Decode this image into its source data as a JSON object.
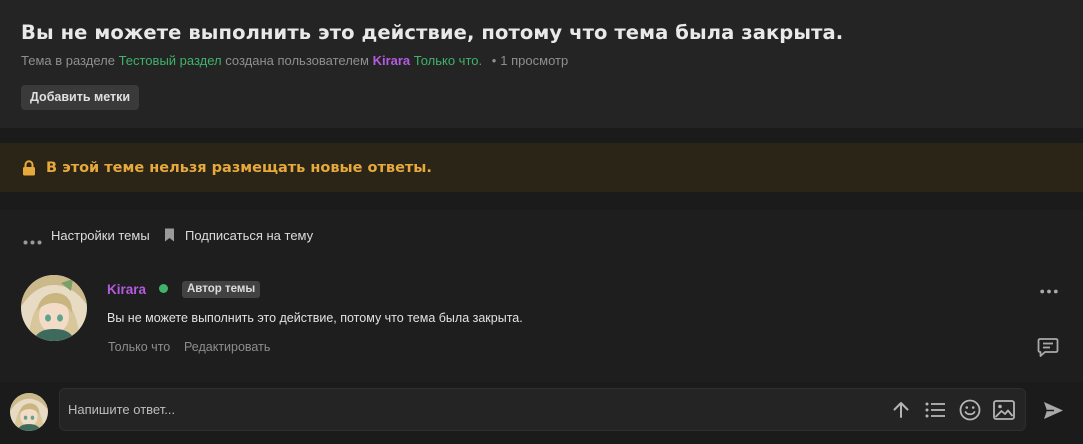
{
  "thread": {
    "title": "Вы не можете выполнить это действие, потому что тема была закрыта.",
    "meta": {
      "prefix": "Тема в разделе",
      "section": "Тестовый раздел",
      "middle": "создана пользователем",
      "author": "Kirara",
      "time": "Только что.",
      "separator": "•",
      "views": "1 просмотр"
    },
    "add_tags_label": "Добавить метки"
  },
  "locked_notice": {
    "text": "В этой теме нельзя размещать новые ответы.",
    "icon": "lock-icon",
    "color": "#e7a93b"
  },
  "tools": {
    "settings_label": "Настройки темы",
    "subscribe_label": "Подписаться на тему"
  },
  "post": {
    "author": "Kirara",
    "badge": "Автор темы",
    "body": "Вы не можете выполнить это действие, потому что тема была закрыта.",
    "time": "Только что",
    "edit_label": "Редактировать"
  },
  "reply": {
    "placeholder": "Напишите ответ..."
  },
  "colors": {
    "accent_green": "#3fb36a",
    "username_purple": "#b45be0",
    "warning": "#e7a93b"
  }
}
